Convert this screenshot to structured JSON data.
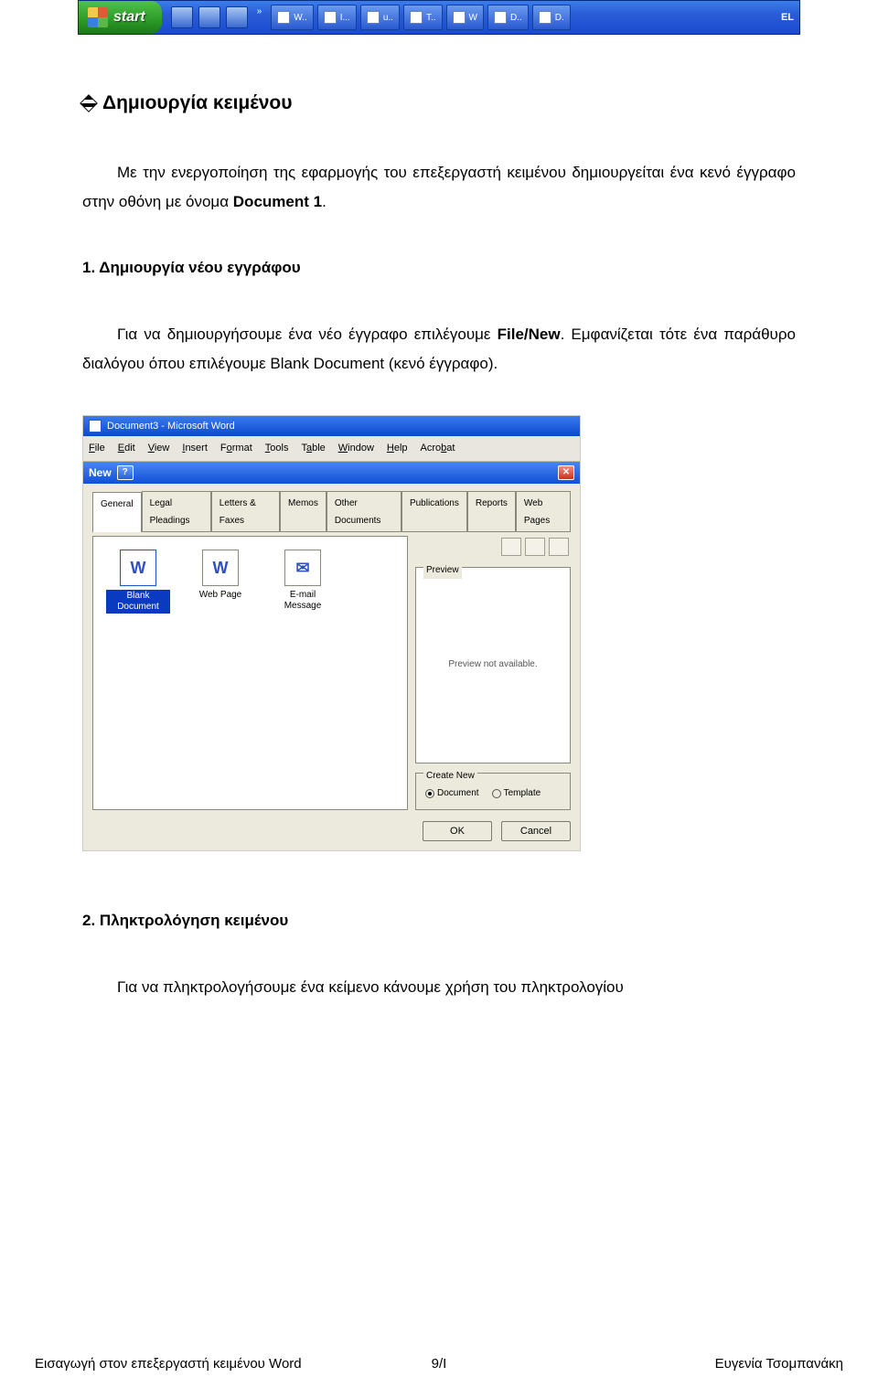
{
  "taskbar": {
    "start": "start",
    "items": [
      "W..",
      "I...",
      "u..",
      "T..",
      "W",
      "D..",
      "D."
    ],
    "lang": "EL"
  },
  "doc": {
    "section_title": "Δημιουργία κειμένου",
    "intro_a": "Με την ενεργοποίηση της εφαρμογής του επεξεργαστή κειμένου δημιουργείται ένα κενό έγγραφο στην οθόνη με όνομα ",
    "intro_b": "Document 1",
    "intro_c": ".",
    "h1_num": "1.",
    "h1_text": " Δημιουργία νέου εγγράφου",
    "p1_a": "Για να δημιουργήσουμε ένα νέο έγγραφο επιλέγουμε ",
    "p1_b": "File/New",
    "p1_c": ". Εμφανίζεται τότε ένα παράθυρο διαλόγου όπου επιλέγουμε Blank Document (κενό έγγραφο).",
    "h2_num": "2.",
    "h2_text": " Πληκτρολόγηση κειμένου",
    "p2": "Για να πληκτρολογήσουμε ένα κείμενο κάνουμε χρήση του πληκτρολογίου"
  },
  "dialog": {
    "word_title": "Document3 - Microsoft Word",
    "menus": [
      "File",
      "Edit",
      "View",
      "Insert",
      "Format",
      "Tools",
      "Table",
      "Window",
      "Help",
      "Acrobat"
    ],
    "dlg_title": "New",
    "tabs": [
      "General",
      "Legal Pleadings",
      "Letters & Faxes",
      "Memos",
      "Other Documents",
      "Publications",
      "Reports",
      "Web Pages"
    ],
    "templates": [
      {
        "label": "Blank Document",
        "selected": true,
        "glyph": "W"
      },
      {
        "label": "Web Page",
        "selected": false,
        "glyph": "W"
      },
      {
        "label": "E-mail Message",
        "selected": false,
        "glyph": "✉"
      }
    ],
    "preview_group": "Preview",
    "preview_msg": "Preview not available.",
    "createnew_group": "Create New",
    "opt_doc": "Document",
    "opt_tmpl": "Template",
    "ok": "OK",
    "cancel": "Cancel"
  },
  "footer": {
    "left": "Εισαγωγή στον επεξεργαστή κειμένου Word",
    "center": "9/Ι",
    "right": "Ευγενία Τσομπανάκη"
  }
}
